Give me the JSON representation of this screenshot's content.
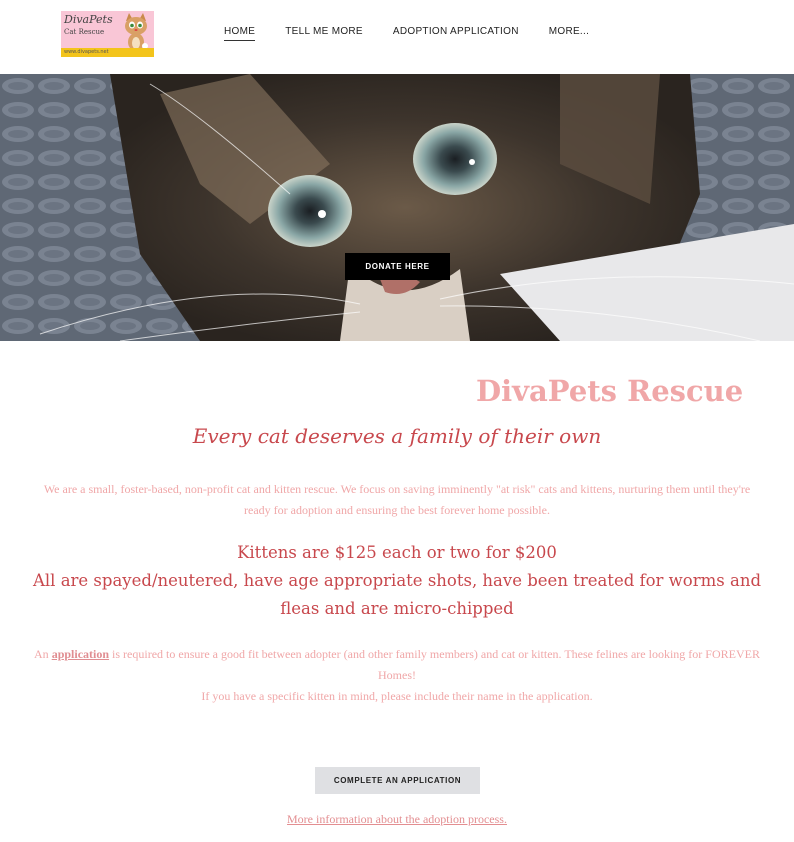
{
  "header": {
    "logo": {
      "title": "DivaPets",
      "subtitle": "Cat Rescue",
      "url": "www.divapets.net"
    },
    "nav": [
      {
        "label": "HOME",
        "active": true
      },
      {
        "label": "TELL ME MORE",
        "active": false
      },
      {
        "label": "ADOPTION APPLICATION",
        "active": false
      },
      {
        "label": "MORE...",
        "active": false
      }
    ]
  },
  "hero": {
    "image": "tabby-kitten-photo",
    "donate_label": "DONATE HERE"
  },
  "main": {
    "title": "DivaPets Rescue",
    "tagline": "Every cat deserves a family of their own",
    "intro": "We are a small, foster-based, non-profit cat and kitten rescue. We focus on saving imminently \"at risk\" cats and kittens, nurturing them until they're ready for adoption and ensuring the best forever home possible.",
    "pricing_line1": "Kittens are $125 each or two for $200",
    "pricing_line2": "All are spayed/neutered, have age appropriate shots, have been treated for worms and fleas and are micro-chipped",
    "apply_prefix": "An",
    "apply_link": "application",
    "apply_rest": "is required to ensure a good fit between adopter (and other family members) and cat or kitten. These felines are looking for FOREVER Homes!",
    "apply_line2": "If you have a specific kitten in mind, please include their name in the application.",
    "cta_label": "COMPLETE AN APPLICATION",
    "more_link": "More information about the adoption process."
  },
  "colors": {
    "title_pink": "#f0a7a8",
    "accent_red": "#c8484d",
    "donate_bg": "#000000",
    "cta_bg": "#dfe0e3"
  }
}
